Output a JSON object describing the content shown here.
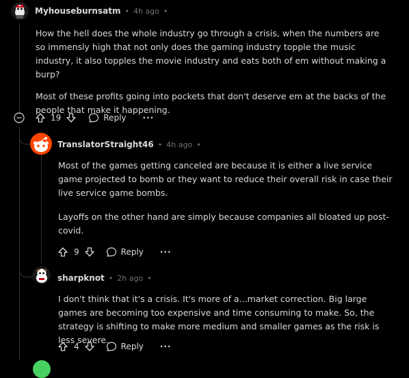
{
  "comments": [
    {
      "author": "Myhouseburnsatm",
      "time": "4h ago",
      "paragraphs": [
        "How the hell does the whole industry go through a crisis, when the numbers are so immensly high that not only does the gaming industry topple the music industry, it also topples the movie industry and eats both of em without making a burp?",
        "Most of these profits going into pockets that don't deserve em at the backs of the people that make it happening."
      ],
      "score": "19",
      "reply_label": "Reply",
      "more_label": "···"
    },
    {
      "author": "TranslatorStraight46",
      "time": "4h ago",
      "paragraphs": [
        "Most of the games getting canceled are because it is either a live service game projected to bomb or they want to reduce their overall risk in case their live service game bombs.",
        "Layoffs on the other hand are simply because companies all bloated up post-covid."
      ],
      "score": "9",
      "reply_label": "Reply",
      "more_label": "···"
    },
    {
      "author": "sharpknot",
      "time": "2h ago",
      "paragraphs": [
        "I don't think that it's a crisis. It's more of a...market correction. Big large games are becoming too expensive and time consuming to make. So, the strategy is shifting to make more medium and smaller games as the risk is less severe."
      ],
      "score": "4",
      "reply_label": "Reply",
      "more_label": "···"
    }
  ],
  "separator": "•",
  "colors": {
    "background": "#000000",
    "text": "#d7dadc",
    "meta": "#6e7275",
    "avatar_orange": "#ff4500",
    "avatar_green": "#46d160"
  },
  "icons": [
    "collapse-icon",
    "upvote-icon",
    "downvote-icon",
    "reply-icon",
    "more-icon"
  ]
}
